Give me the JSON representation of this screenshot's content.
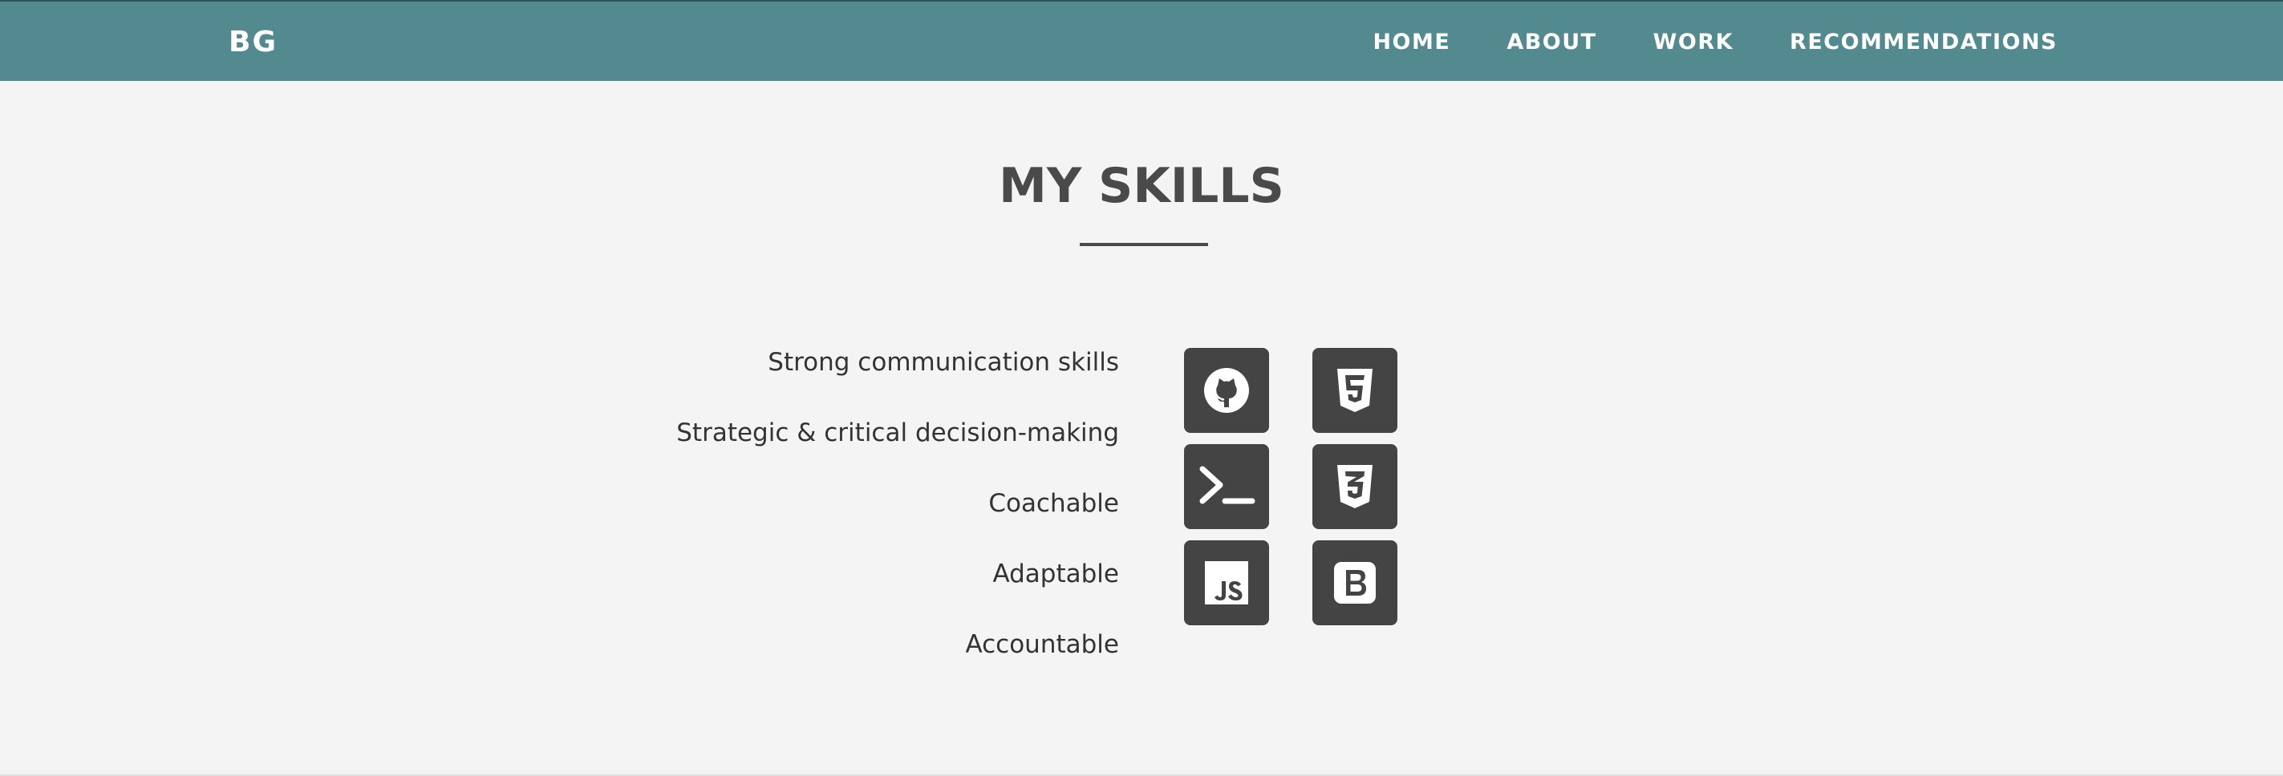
{
  "navbar": {
    "brand": "BG",
    "links": [
      {
        "label": "HOME"
      },
      {
        "label": "ABOUT"
      },
      {
        "label": "WORK"
      },
      {
        "label": "RECOMMENDATIONS"
      }
    ],
    "background_color": "#538a90"
  },
  "section": {
    "title": "MY SKILLS",
    "skills": [
      "Strong communication skills",
      "Strategic & critical decision-making",
      "Coachable",
      "Adaptable",
      "Accountable"
    ],
    "icons": [
      {
        "name": "github-icon"
      },
      {
        "name": "html5-icon"
      },
      {
        "name": "terminal-icon"
      },
      {
        "name": "css3-icon"
      },
      {
        "name": "javascript-icon"
      },
      {
        "name": "bootstrap-icon"
      }
    ],
    "icon_tile_color": "#444444",
    "text_color": "#4a4a4a"
  }
}
